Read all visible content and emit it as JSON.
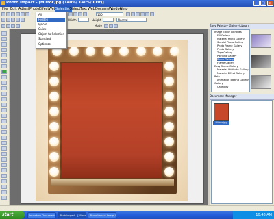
{
  "window": {
    "title": "Photo Impact - [Mirror.jpg (140%/ 140%/ Crit)]",
    "controls": [
      "_",
      "□",
      "x"
    ]
  },
  "menubar": {
    "items": [
      "File",
      "Edit",
      "Adjust",
      "Photo",
      "Effect",
      "Web",
      "Selection",
      "Object",
      "Text",
      "Web",
      "Document",
      "Window",
      "Help"
    ],
    "active_index": 6
  },
  "toolbar": {
    "mode_value": "All",
    "width_label": "Width",
    "height_label": "Height",
    "mode_label": "Mode",
    "mode2_value": "Normal",
    "zoom_value": "100"
  },
  "dropdown": {
    "items": [
      "All",
      "Hidden",
      "Ignore",
      "Quick",
      "Object to Selection",
      "Standard",
      "Optimize"
    ],
    "selected_index": 1
  },
  "right_panel": {
    "header": "Easy Palette - Gallery/Library",
    "tree_items": [
      "Image Editor Libraries",
      "Fill Gallery",
      "Material Photo Gallery",
      "Special Photo Gallery",
      "Photo Frame Gallery",
      "Photo Gallery",
      "Type Gallery",
      "Painting Gallery",
      "Brush Gallery",
      "Frame Gallery",
      "Easy Shade Gallery",
      "Material Attribute Gallery",
      "Material Effect Gallery",
      "Path",
      "Animation Editing Gallery",
      "Gallery",
      "Category"
    ],
    "recent_header": "Document Manager",
    "recent_label": "Mirror.jpg"
  },
  "taskbar": {
    "start_label": "start",
    "tasks": [
      "Inventory Document S...",
      "Photoimpact - [Mirror...",
      "Photo Impact Image Ed..."
    ],
    "active_task_index": 1,
    "clock": "10:48 AM"
  },
  "colors": {
    "accent": "#316ac5",
    "mirror": "#c34a2b",
    "taskbar": "#245edc"
  }
}
